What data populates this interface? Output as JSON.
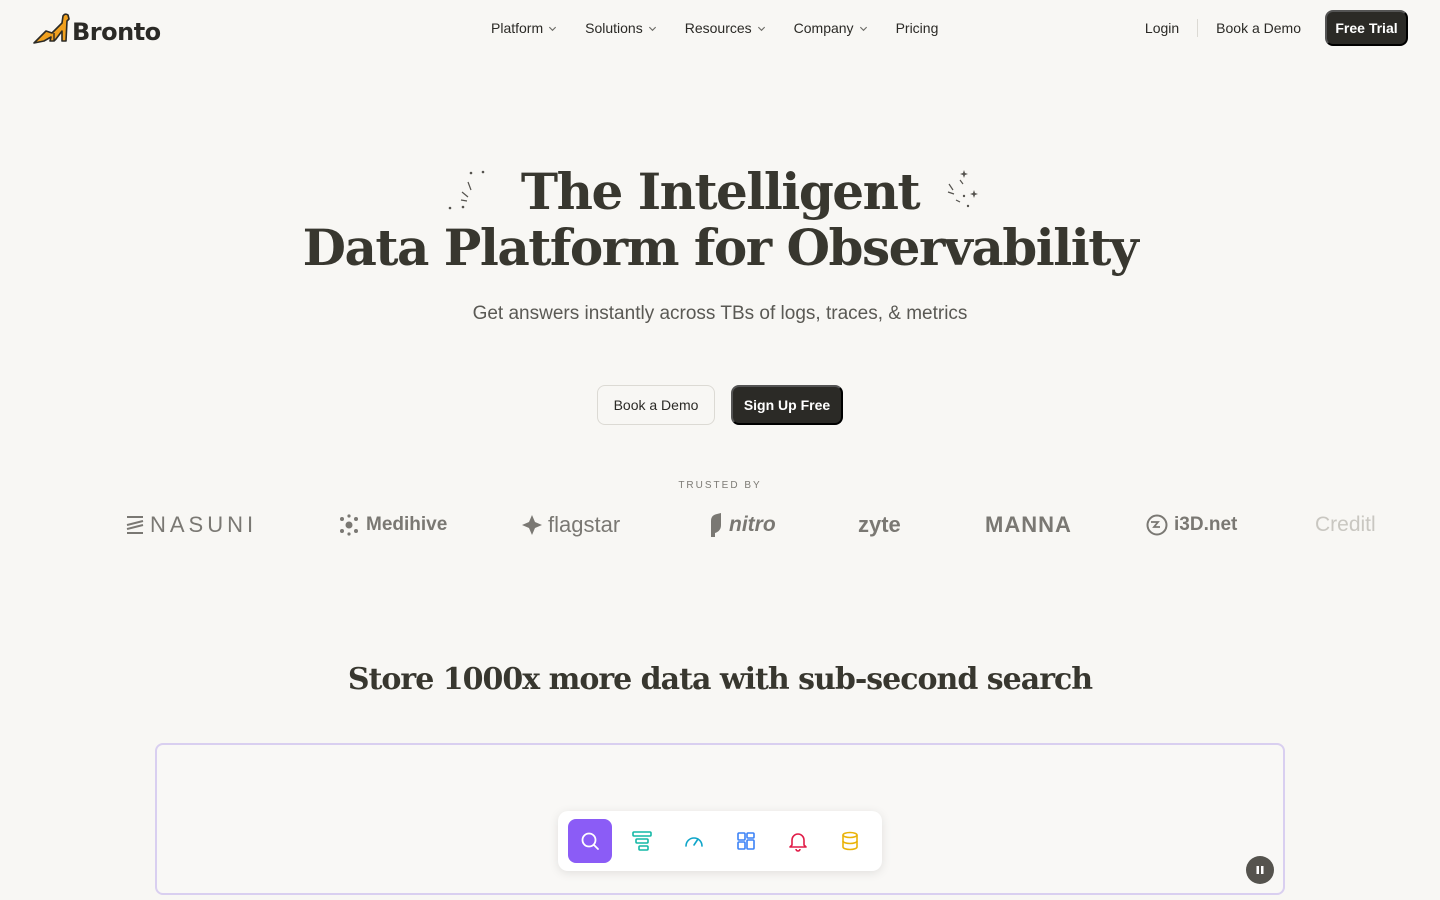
{
  "nav": {
    "brand": "Bronto",
    "menu": [
      {
        "label": "Platform"
      },
      {
        "label": "Solutions"
      },
      {
        "label": "Resources"
      },
      {
        "label": "Company"
      },
      {
        "label": "Pricing"
      }
    ],
    "login": "Login",
    "book_demo": "Book a Demo",
    "free_trial": "Free Trial"
  },
  "hero": {
    "title_line1": "The Intelligent",
    "title_line2": "Data Platform for Observability",
    "subtitle": "Get answers instantly across TBs of logs, traces, & metrics",
    "book_demo": "Book a Demo",
    "sign_up": "Sign Up Free"
  },
  "trusted": {
    "label": "TRUSTED BY",
    "logos": [
      "NASUNI",
      "Medihive",
      "flagstar",
      "nitro",
      "zyte",
      "MANNA",
      "i3D.net",
      "Creditl"
    ]
  },
  "section": {
    "title": "Store 1000x more data with sub-second search"
  },
  "toolbar": {
    "items": [
      {
        "icon": "search-icon",
        "color": "#ffffff",
        "active": true
      },
      {
        "icon": "filter-layers-icon",
        "color": "#14b8a6"
      },
      {
        "icon": "gauge-icon",
        "color": "#0ea5c9"
      },
      {
        "icon": "dashboard-grid-icon",
        "color": "#3b82f6"
      },
      {
        "icon": "bell-icon",
        "color": "#e11d48"
      },
      {
        "icon": "database-icon",
        "color": "#eab308"
      }
    ]
  },
  "colors": {
    "background": "#f8f7f4",
    "dark_button": "#2b2a26",
    "accent_purple": "#8b5cf6",
    "logo_orange": "#f0a01e"
  }
}
